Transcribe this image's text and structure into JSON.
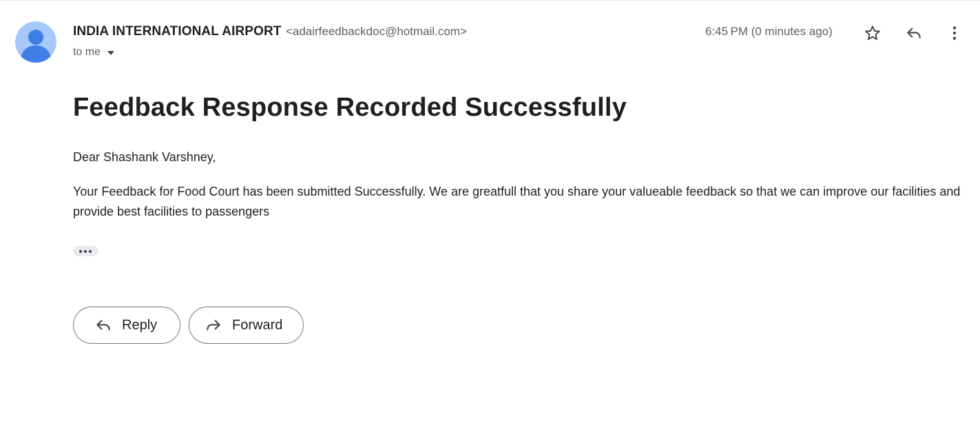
{
  "message": {
    "sender_name": "INDIA INTERNATIONAL AIRPORT",
    "sender_email": "<adairfeedbackdoc@hotmail.com>",
    "recipient_label": "to me",
    "timestamp": "6:45 PM (0 minutes ago)",
    "subject": "Feedback Response Recorded Successfully",
    "greeting": "Dear Shashank Varshney,",
    "body": "Your Feedback for Food Court has been submitted Successfully. We are greatfull that you share your valueable feedback so that we can improve our facilities and provide best facilities to passengers"
  },
  "actions": {
    "reply_label": "Reply",
    "forward_label": "Forward"
  },
  "icons": {
    "avatar": "default-avatar-icon",
    "star": "star-icon",
    "reply": "reply-icon",
    "more": "more-vert-icon",
    "expand": "ellipsis-icon",
    "forward": "forward-icon"
  },
  "colors": {
    "avatar_bg": "#a8c7fa",
    "avatar_fg": "#3f7ee8",
    "border": "#747775",
    "secondary_text": "#5e5e5e"
  }
}
